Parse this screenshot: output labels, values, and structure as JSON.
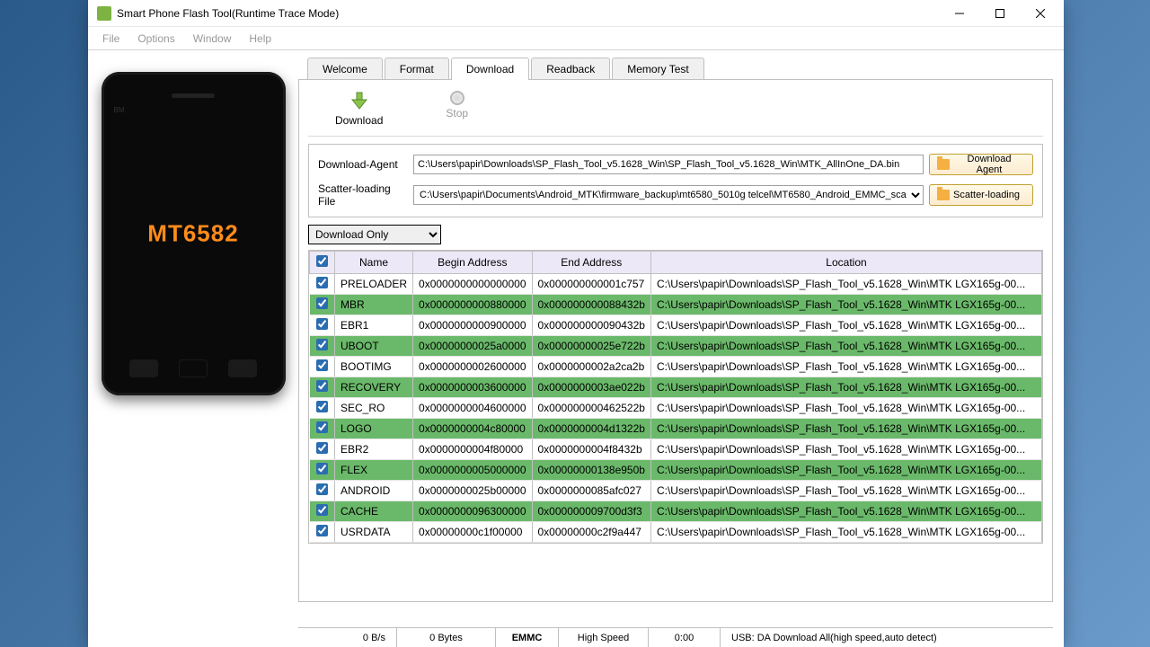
{
  "window": {
    "title": "Smart Phone Flash Tool(Runtime Trace Mode)"
  },
  "menu": {
    "file": "File",
    "options": "Options",
    "window": "Window",
    "help": "Help"
  },
  "phone": {
    "chip": "MT6582",
    "bm": "BM"
  },
  "tabs": {
    "welcome": "Welcome",
    "format": "Format",
    "download": "Download",
    "readback": "Readback",
    "memtest": "Memory Test"
  },
  "toolbar": {
    "download": "Download",
    "stop": "Stop"
  },
  "files": {
    "da_label": "Download-Agent",
    "da_path": "C:\\Users\\papir\\Downloads\\SP_Flash_Tool_v5.1628_Win\\SP_Flash_Tool_v5.1628_Win\\MTK_AllInOne_DA.bin",
    "da_btn": "Download Agent",
    "scatter_label": "Scatter-loading File",
    "scatter_path": "C:\\Users\\papir\\Documents\\Android_MTK\\firmware_backup\\mt6580_5010g telcel\\MT6580_Android_EMMC_sca",
    "scatter_btn": "Scatter-loading"
  },
  "mode": "Download Only",
  "table": {
    "headers": {
      "name": "Name",
      "begin": "Begin Address",
      "end": "End Address",
      "location": "Location"
    },
    "rows": [
      {
        "hl": false,
        "name": "PRELOADER",
        "begin": "0x0000000000000000",
        "end": "0x000000000001c757",
        "loc": "C:\\Users\\papir\\Downloads\\SP_Flash_Tool_v5.1628_Win\\MTK LGX165g-00..."
      },
      {
        "hl": true,
        "name": "MBR",
        "begin": "0x0000000000880000",
        "end": "0x000000000088432b",
        "loc": "C:\\Users\\papir\\Downloads\\SP_Flash_Tool_v5.1628_Win\\MTK LGX165g-00..."
      },
      {
        "hl": false,
        "name": "EBR1",
        "begin": "0x0000000000900000",
        "end": "0x000000000090432b",
        "loc": "C:\\Users\\papir\\Downloads\\SP_Flash_Tool_v5.1628_Win\\MTK LGX165g-00..."
      },
      {
        "hl": true,
        "name": "UBOOT",
        "begin": "0x00000000025a0000",
        "end": "0x00000000025e722b",
        "loc": "C:\\Users\\papir\\Downloads\\SP_Flash_Tool_v5.1628_Win\\MTK LGX165g-00..."
      },
      {
        "hl": false,
        "name": "BOOTIMG",
        "begin": "0x0000000002600000",
        "end": "0x0000000002a2ca2b",
        "loc": "C:\\Users\\papir\\Downloads\\SP_Flash_Tool_v5.1628_Win\\MTK LGX165g-00..."
      },
      {
        "hl": true,
        "name": "RECOVERY",
        "begin": "0x0000000003600000",
        "end": "0x0000000003ae022b",
        "loc": "C:\\Users\\papir\\Downloads\\SP_Flash_Tool_v5.1628_Win\\MTK LGX165g-00..."
      },
      {
        "hl": false,
        "name": "SEC_RO",
        "begin": "0x0000000004600000",
        "end": "0x000000000462522b",
        "loc": "C:\\Users\\papir\\Downloads\\SP_Flash_Tool_v5.1628_Win\\MTK LGX165g-00..."
      },
      {
        "hl": true,
        "name": "LOGO",
        "begin": "0x0000000004c80000",
        "end": "0x0000000004d1322b",
        "loc": "C:\\Users\\papir\\Downloads\\SP_Flash_Tool_v5.1628_Win\\MTK LGX165g-00..."
      },
      {
        "hl": false,
        "name": "EBR2",
        "begin": "0x0000000004f80000",
        "end": "0x0000000004f8432b",
        "loc": "C:\\Users\\papir\\Downloads\\SP_Flash_Tool_v5.1628_Win\\MTK LGX165g-00..."
      },
      {
        "hl": true,
        "name": "FLEX",
        "begin": "0x0000000005000000",
        "end": "0x00000000138e950b",
        "loc": "C:\\Users\\papir\\Downloads\\SP_Flash_Tool_v5.1628_Win\\MTK LGX165g-00..."
      },
      {
        "hl": false,
        "name": "ANDROID",
        "begin": "0x0000000025b00000",
        "end": "0x0000000085afc027",
        "loc": "C:\\Users\\papir\\Downloads\\SP_Flash_Tool_v5.1628_Win\\MTK LGX165g-00..."
      },
      {
        "hl": true,
        "name": "CACHE",
        "begin": "0x0000000096300000",
        "end": "0x000000009700d3f3",
        "loc": "C:\\Users\\papir\\Downloads\\SP_Flash_Tool_v5.1628_Win\\MTK LGX165g-00..."
      },
      {
        "hl": false,
        "name": "USRDATA",
        "begin": "0x00000000c1f00000",
        "end": "0x00000000c2f9a447",
        "loc": "C:\\Users\\papir\\Downloads\\SP_Flash_Tool_v5.1628_Win\\MTK LGX165g-00..."
      }
    ]
  },
  "status": {
    "speed": "0 B/s",
    "bytes": "0 Bytes",
    "storage": "EMMC",
    "mode": "High Speed",
    "time": "0:00",
    "usb": "USB: DA Download All(high speed,auto detect)"
  }
}
